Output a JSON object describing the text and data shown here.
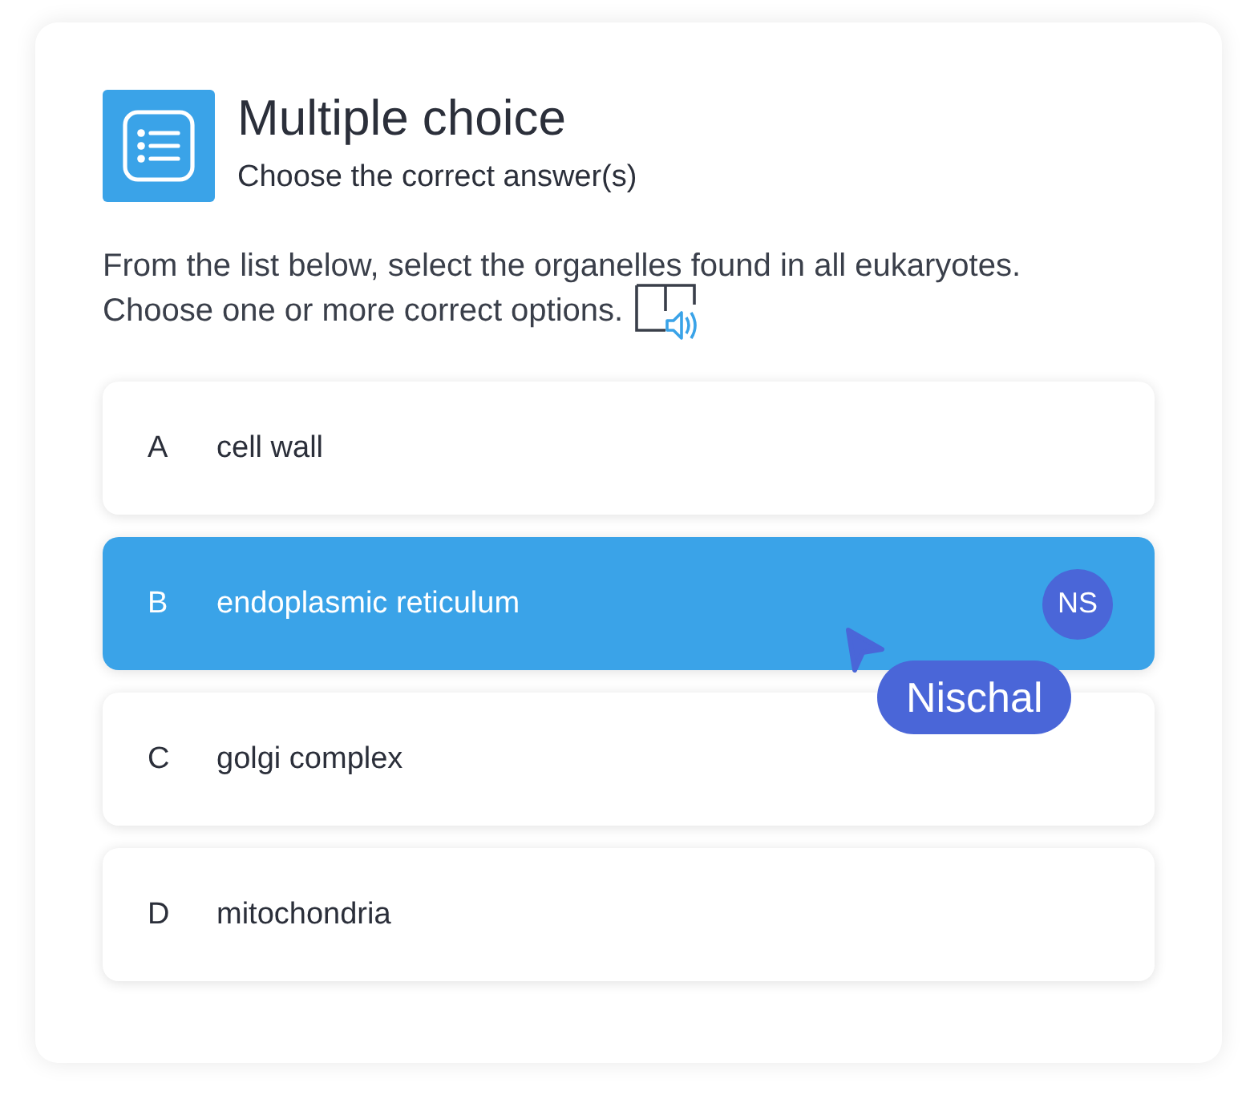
{
  "header": {
    "title": "Multiple choice",
    "subtitle": "Choose the correct answer(s)"
  },
  "prompt": [
    "From the list below, select the organelles found in all eukaryotes.",
    "Choose one or more correct options."
  ],
  "options": [
    {
      "letter": "A",
      "text": "cell wall",
      "selected": false
    },
    {
      "letter": "B",
      "text": "endoplasmic reticulum",
      "selected": true,
      "avatar": "NS"
    },
    {
      "letter": "C",
      "text": "golgi complex",
      "selected": false
    },
    {
      "letter": "D",
      "text": "mitochondria",
      "selected": false
    }
  ],
  "cursor": {
    "name": "Nischal"
  }
}
